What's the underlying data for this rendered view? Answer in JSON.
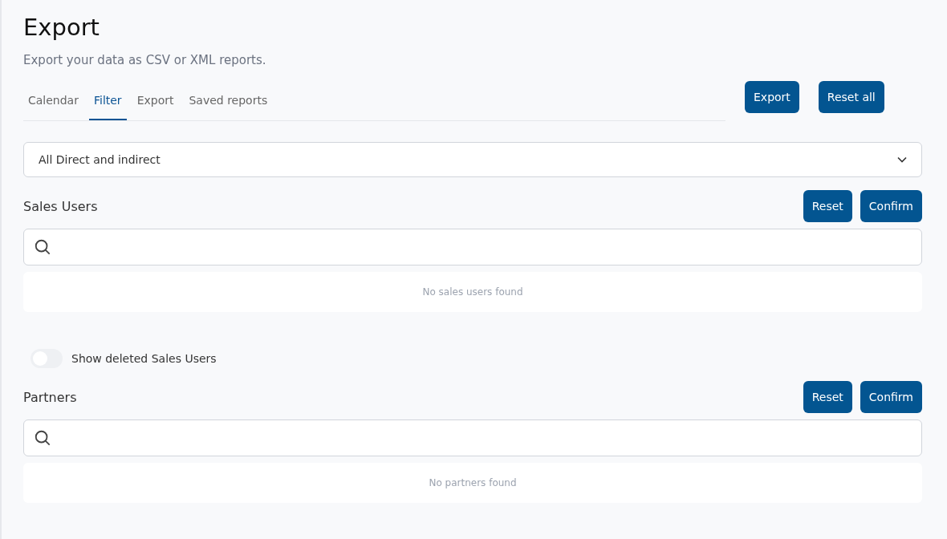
{
  "header": {
    "title": "Export",
    "subtitle": "Export your data as CSV or XML reports."
  },
  "tabs": [
    {
      "label": "Calendar",
      "selected": false
    },
    {
      "label": "Filter",
      "selected": true
    },
    {
      "label": "Export",
      "selected": false
    },
    {
      "label": "Saved reports",
      "selected": false
    }
  ],
  "actions": [
    "Export",
    "Reset all"
  ],
  "dropdown": {
    "value": "All Direct and indirect"
  },
  "sections": [
    {
      "title": "Sales Users",
      "buttons": [
        "Reset",
        "Confirm"
      ],
      "empty_message": "No sales users found",
      "toggle": {
        "label": "Show deleted Sales Users",
        "on": false
      }
    },
    {
      "title": "Partners",
      "buttons": [
        "Reset",
        "Confirm"
      ],
      "empty_message": "No partners found"
    }
  ]
}
